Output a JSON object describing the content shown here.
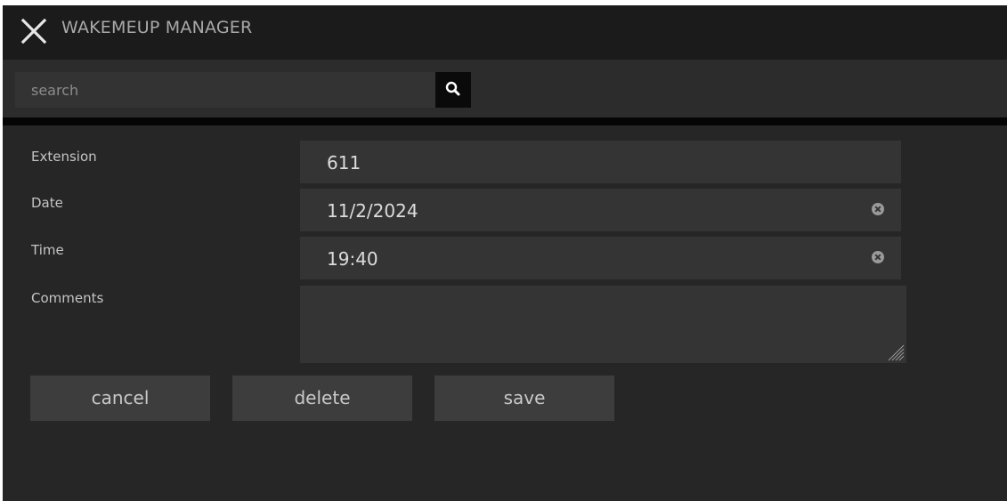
{
  "window": {
    "title": "WAKEMEUP MANAGER",
    "close_icon": "close-x-icon"
  },
  "search": {
    "placeholder": "search",
    "value": "",
    "icon": "magnifier-icon"
  },
  "form": {
    "extension": {
      "label": "Extension",
      "value": "611"
    },
    "date": {
      "label": "Date",
      "value": "11/2/2024",
      "clear_icon": "clear-circle-x-icon"
    },
    "time": {
      "label": "Time",
      "value": "19:40",
      "clear_icon": "clear-circle-x-icon"
    },
    "comments": {
      "label": "Comments",
      "value": ""
    }
  },
  "actions": {
    "cancel_label": "cancel",
    "delete_label": "delete",
    "save_label": "save"
  },
  "colors": {
    "titlebar_bg": "#1b1b1b",
    "panel_bg": "#262626",
    "field_bg": "#343434",
    "button_bg": "#3d3d3d",
    "search_button_bg": "#0a0a0a",
    "text": "#c4c4c4"
  }
}
